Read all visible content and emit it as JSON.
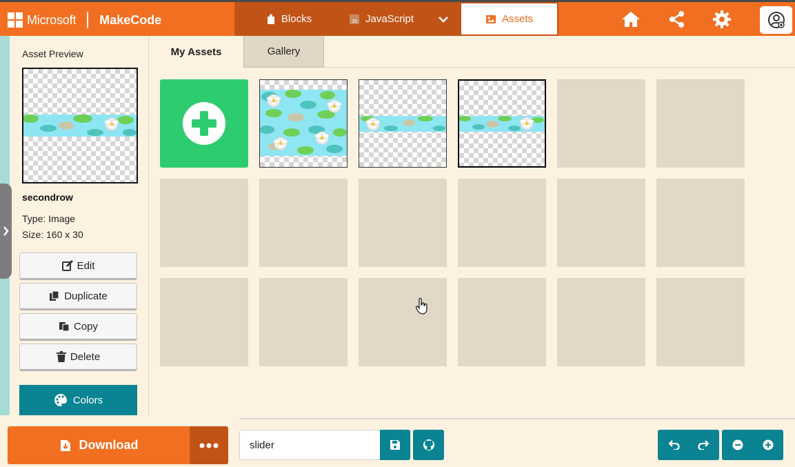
{
  "header": {
    "brand_ms": "Microsoft",
    "brand_app": "MakeCode",
    "tabs": [
      {
        "label": "Blocks",
        "icon": "puzzle-icon"
      },
      {
        "label": "JavaScript",
        "icon": "js-icon"
      },
      {
        "label": "Assets",
        "icon": "image-icon",
        "active": true
      }
    ],
    "icons": [
      "home-icon",
      "share-icon",
      "gear-icon",
      "user-icon"
    ]
  },
  "sidebar": {
    "title": "Asset Preview",
    "asset_name": "secondrow",
    "type_line": "Type: Image",
    "size_line": "Size: 160 x 30",
    "buttons": {
      "edit": "Edit",
      "duplicate": "Duplicate",
      "copy": "Copy",
      "delete": "Delete",
      "colors": "Colors"
    }
  },
  "asset_tabs": {
    "my_assets": "My Assets",
    "gallery": "Gallery"
  },
  "grid": {
    "columns": 6,
    "rows": 3,
    "assets": [
      "lilypad-full",
      "lilypad-strip",
      "secondrow"
    ],
    "selected": "secondrow"
  },
  "footer": {
    "download_label": "Download",
    "project_name": "slider",
    "icons": [
      "save-icon",
      "github-icon",
      "undo-icon",
      "redo-icon",
      "zoom-out-icon",
      "zoom-in-icon"
    ]
  },
  "colors": {
    "accent_orange": "#f26f21",
    "dark_orange": "#c15316",
    "teal": "#0a8392",
    "green": "#2ecc71",
    "bg": "#fdf2e0"
  }
}
